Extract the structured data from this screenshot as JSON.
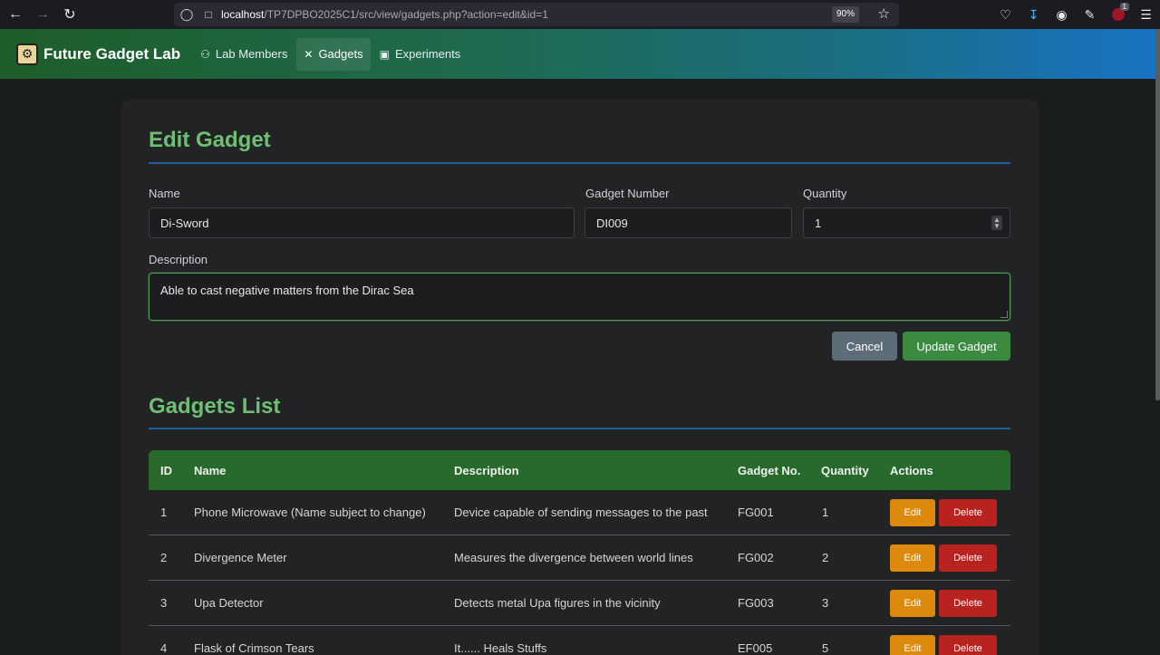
{
  "browser": {
    "url_host": "localhost",
    "url_path": "/TP7DPBO2025C1/src/view/gadgets.php?action=edit&id=1",
    "zoom": "90%",
    "extension_badge": "1"
  },
  "nav": {
    "brand": "Future Gadget Lab",
    "links": [
      {
        "label": "Lab Members",
        "icon": "users-icon"
      },
      {
        "label": "Gadgets",
        "icon": "tools-icon"
      },
      {
        "label": "Experiments",
        "icon": "chart-icon"
      }
    ]
  },
  "form": {
    "title": "Edit Gadget",
    "name_label": "Name",
    "name_value": "Di-Sword",
    "number_label": "Gadget Number",
    "number_value": "DI009",
    "quantity_label": "Quantity",
    "quantity_value": "1",
    "description_label": "Description",
    "description_value": "Able to cast negative matters from the Dirac Sea",
    "cancel_label": "Cancel",
    "update_label": "Update Gadget"
  },
  "list": {
    "title": "Gadgets List",
    "headers": {
      "id": "ID",
      "name": "Name",
      "description": "Description",
      "number": "Gadget No.",
      "quantity": "Quantity",
      "actions": "Actions"
    },
    "edit_label": "Edit",
    "delete_label": "Delete",
    "rows": [
      {
        "id": "1",
        "name": "Phone Microwave (Name subject to change)",
        "description": "Device capable of sending messages to the past",
        "number": "FG001",
        "quantity": "1"
      },
      {
        "id": "2",
        "name": "Divergence Meter",
        "description": "Measures the divergence between world lines",
        "number": "FG002",
        "quantity": "2"
      },
      {
        "id": "3",
        "name": "Upa Detector",
        "description": "Detects metal Upa figures in the vicinity",
        "number": "FG003",
        "quantity": "3"
      },
      {
        "id": "4",
        "name": "Flask of Crimson Tears",
        "description": "It...... Heals Stuffs",
        "number": "EF005",
        "quantity": "5"
      }
    ]
  }
}
